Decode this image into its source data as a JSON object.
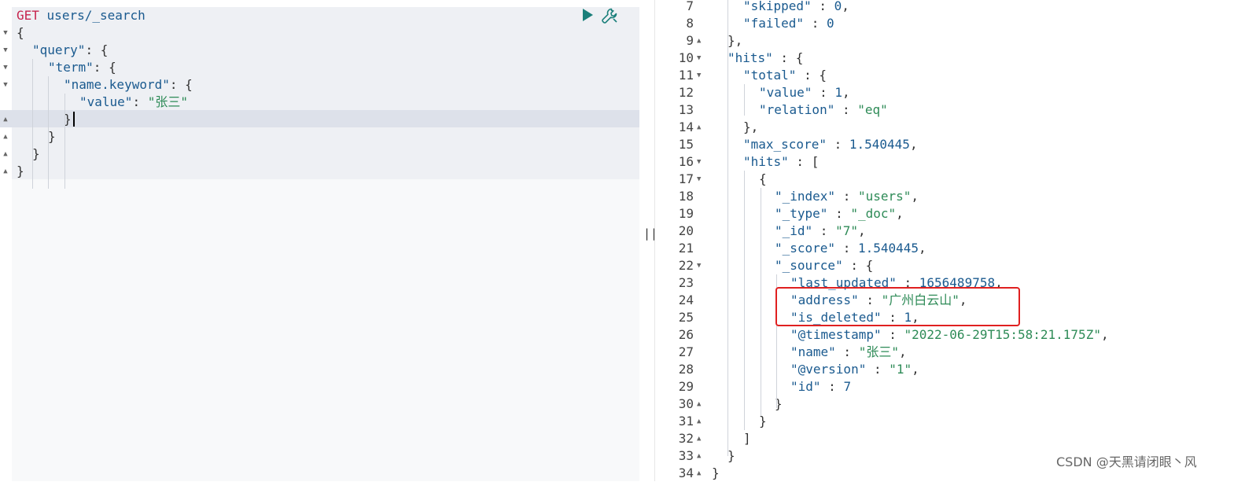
{
  "request": {
    "method": "GET",
    "path": "users/_search",
    "lines": [
      {
        "indent": 0,
        "text": "{"
      },
      {
        "indent": 1,
        "key": "\"query\"",
        "after": ": {"
      },
      {
        "indent": 2,
        "key": "\"term\"",
        "after": ": {"
      },
      {
        "indent": 3,
        "key": "\"name.keyword\"",
        "after": ": {"
      },
      {
        "indent": 4,
        "key": "\"value\"",
        "sep": ": ",
        "str": "\"张三\""
      },
      {
        "indent": 3,
        "text": "}"
      },
      {
        "indent": 2,
        "text": "}"
      },
      {
        "indent": 1,
        "text": "}"
      },
      {
        "indent": 0,
        "text": "}"
      }
    ]
  },
  "toolbar": {
    "run_icon": "play-icon",
    "settings_icon": "wrench-icon"
  },
  "splitter": {
    "glyph": "||"
  },
  "response": {
    "lines": [
      {
        "num": "7",
        "fold": "",
        "indent": 2,
        "key": "\"skipped\"",
        "sep": " : ",
        "num_val": "0",
        "tail": ","
      },
      {
        "num": "8",
        "fold": "",
        "indent": 2,
        "key": "\"failed\"",
        "sep": " : ",
        "num_val": "0",
        "tail": ""
      },
      {
        "num": "9",
        "fold": "▲",
        "indent": 1,
        "text": "},"
      },
      {
        "num": "10",
        "fold": "▼",
        "indent": 1,
        "key": "\"hits\"",
        "sep": " : ",
        "tail": "{"
      },
      {
        "num": "11",
        "fold": "▼",
        "indent": 2,
        "key": "\"total\"",
        "sep": " : ",
        "tail": "{"
      },
      {
        "num": "12",
        "fold": "",
        "indent": 3,
        "key": "\"value\"",
        "sep": " : ",
        "num_val": "1",
        "tail": ","
      },
      {
        "num": "13",
        "fold": "",
        "indent": 3,
        "key": "\"relation\"",
        "sep": " : ",
        "str": "\"eq\"",
        "tail": ""
      },
      {
        "num": "14",
        "fold": "▲",
        "indent": 2,
        "text": "},"
      },
      {
        "num": "15",
        "fold": "",
        "indent": 2,
        "key": "\"max_score\"",
        "sep": " : ",
        "num_val": "1.540445",
        "tail": ","
      },
      {
        "num": "16",
        "fold": "▼",
        "indent": 2,
        "key": "\"hits\"",
        "sep": " : ",
        "tail": "["
      },
      {
        "num": "17",
        "fold": "▼",
        "indent": 3,
        "text": "{"
      },
      {
        "num": "18",
        "fold": "",
        "indent": 4,
        "key": "\"_index\"",
        "sep": " : ",
        "str": "\"users\"",
        "tail": ","
      },
      {
        "num": "19",
        "fold": "",
        "indent": 4,
        "key": "\"_type\"",
        "sep": " : ",
        "str": "\"_doc\"",
        "tail": ","
      },
      {
        "num": "20",
        "fold": "",
        "indent": 4,
        "key": "\"_id\"",
        "sep": " : ",
        "str": "\"7\"",
        "tail": ","
      },
      {
        "num": "21",
        "fold": "",
        "indent": 4,
        "key": "\"_score\"",
        "sep": " : ",
        "num_val": "1.540445",
        "tail": ","
      },
      {
        "num": "22",
        "fold": "▼",
        "indent": 4,
        "key": "\"_source\"",
        "sep": " : ",
        "tail": "{"
      },
      {
        "num": "23",
        "fold": "",
        "indent": 5,
        "key": "\"last_updated\"",
        "sep": " : ",
        "num_val": "1656489758",
        "tail": ","
      },
      {
        "num": "24",
        "fold": "",
        "indent": 5,
        "key": "\"address\"",
        "sep": " : ",
        "str": "\"广州白云山\"",
        "tail": ","
      },
      {
        "num": "25",
        "fold": "",
        "indent": 5,
        "key": "\"is_deleted\"",
        "sep": " : ",
        "num_val": "1",
        "tail": ","
      },
      {
        "num": "26",
        "fold": "",
        "indent": 5,
        "key": "\"@timestamp\"",
        "sep": " : ",
        "str": "\"2022-06-29T15:58:21.175Z\"",
        "tail": ","
      },
      {
        "num": "27",
        "fold": "",
        "indent": 5,
        "key": "\"name\"",
        "sep": " : ",
        "str": "\"张三\"",
        "tail": ","
      },
      {
        "num": "28",
        "fold": "",
        "indent": 5,
        "key": "\"@version\"",
        "sep": " : ",
        "str": "\"1\"",
        "tail": ","
      },
      {
        "num": "29",
        "fold": "",
        "indent": 5,
        "key": "\"id\"",
        "sep": " : ",
        "num_val": "7",
        "tail": ""
      },
      {
        "num": "30",
        "fold": "▲",
        "indent": 4,
        "text": "}"
      },
      {
        "num": "31",
        "fold": "▲",
        "indent": 3,
        "text": "}"
      },
      {
        "num": "32",
        "fold": "▲",
        "indent": 2,
        "text": "]"
      },
      {
        "num": "33",
        "fold": "▲",
        "indent": 1,
        "text": "}"
      },
      {
        "num": "34",
        "fold": "▲",
        "indent": 0,
        "text": "}"
      }
    ]
  },
  "watermark": "CSDN @天黑请闭眼丶风"
}
